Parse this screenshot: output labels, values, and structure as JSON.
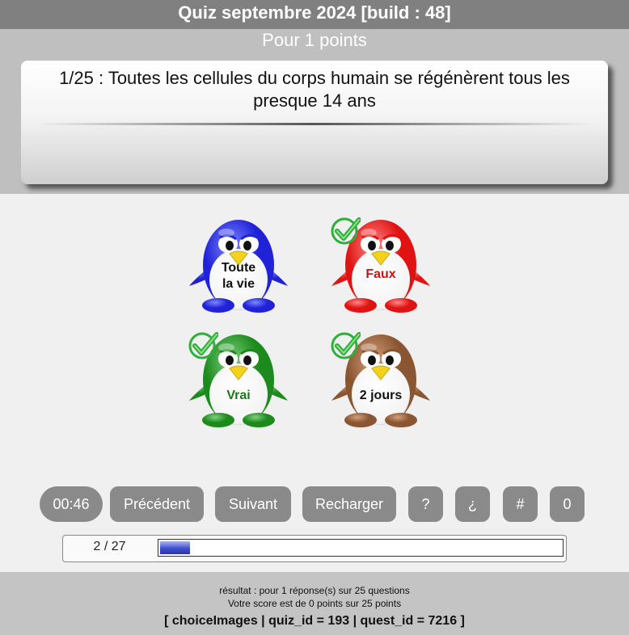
{
  "title": "Quiz septembre 2024 [build : 48]",
  "points_text": "Pour 1 points",
  "question": "1/25 : Toutes les cellules du corps humain se régénèrent tous les presque 14 ans",
  "answers": [
    {
      "label": "Toute\nla vie",
      "color": "#1f22d6",
      "light": "#7f86ff",
      "checked": false,
      "text_color": "#111111"
    },
    {
      "label": "Faux",
      "color": "#e01212",
      "light": "#ff8a8a",
      "checked": true,
      "text_color": "#c91414"
    },
    {
      "label": "Vrai",
      "color": "#1c8a1c",
      "light": "#7ed07e",
      "checked": true,
      "text_color": "#177a17"
    },
    {
      "label": "2 jours",
      "color": "#8a5632",
      "light": "#d4a07a",
      "checked": true,
      "text_color": "#111111"
    }
  ],
  "controls": {
    "timer": "00:46",
    "previous": "Précédent",
    "next": "Suivant",
    "reload": "Recharger",
    "help": "?",
    "inverted_q": "¿",
    "hash": "#",
    "zero": "0"
  },
  "progress": {
    "label": "2 / 27",
    "fraction": 0.074
  },
  "footer": {
    "result": "résultat : pour 1 réponse(s) sur 25 questions",
    "score": "Votre score est de 0 points sur 25 points",
    "debug": "[ choiceImages | quiz_id = 193 | quest_id = 7216 ]"
  }
}
